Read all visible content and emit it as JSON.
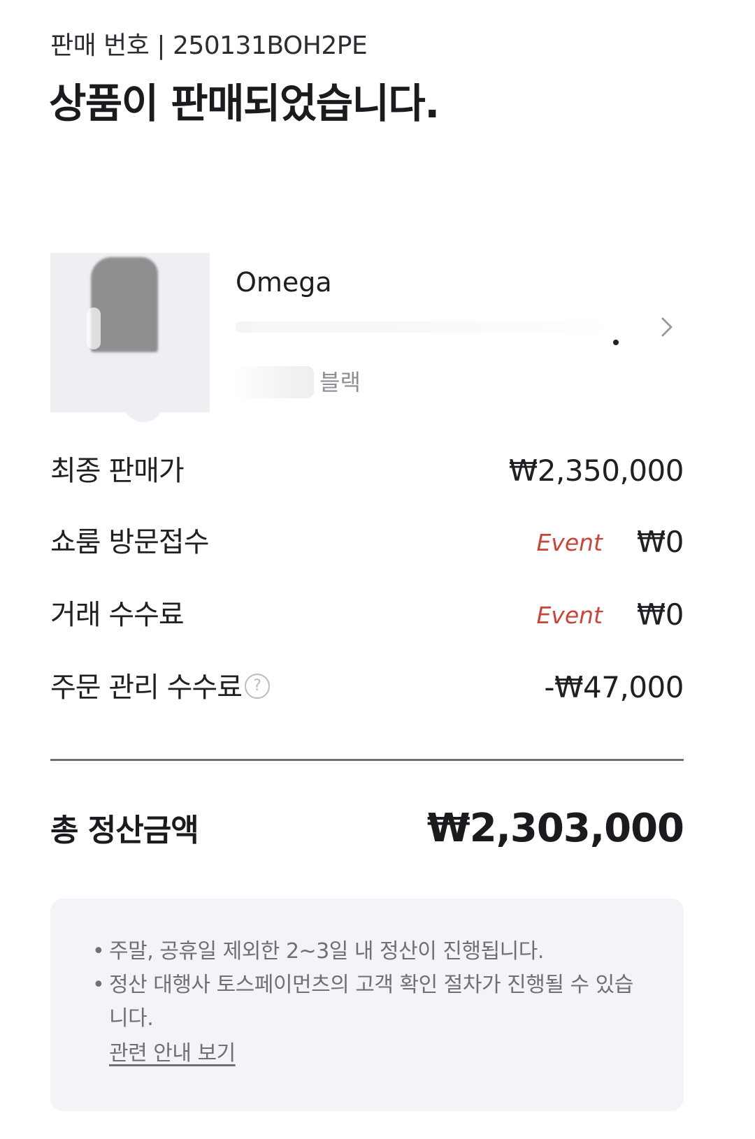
{
  "header": {
    "sale_number": "판매 번호 | 250131BOH2PE",
    "title": "상품이 판매되었습니다."
  },
  "product": {
    "brand": "Omega",
    "option_text": "블랙",
    "chevron_icon": "chevron-right-icon"
  },
  "rows": {
    "final_price": {
      "label": "최종 판매가",
      "value": "₩2,350,000"
    },
    "showroom": {
      "label": "쇼룸 방문접수",
      "badge": "Event",
      "value": "₩0"
    },
    "transaction_fee": {
      "label": "거래 수수료",
      "badge": "Event",
      "value": "₩0"
    },
    "order_fee": {
      "label": "주문 관리 수수료",
      "help_icon": "?",
      "value": "-₩47,000"
    }
  },
  "total": {
    "label": "총 정산금액",
    "value": "₩2,303,000"
  },
  "notice": {
    "items": [
      "주말, 공휴일 제외한 2~3일 내 정산이 진행됩니다.",
      "정산 대행사 토스페이먼츠의 고객 확인 절차가 진행될 수 있습니다."
    ],
    "link": "관련 안내 보기"
  },
  "colors": {
    "event": "#c8453b",
    "text": "#1f2024",
    "muted": "#6d7077",
    "notice_bg": "#f3f4f7"
  }
}
